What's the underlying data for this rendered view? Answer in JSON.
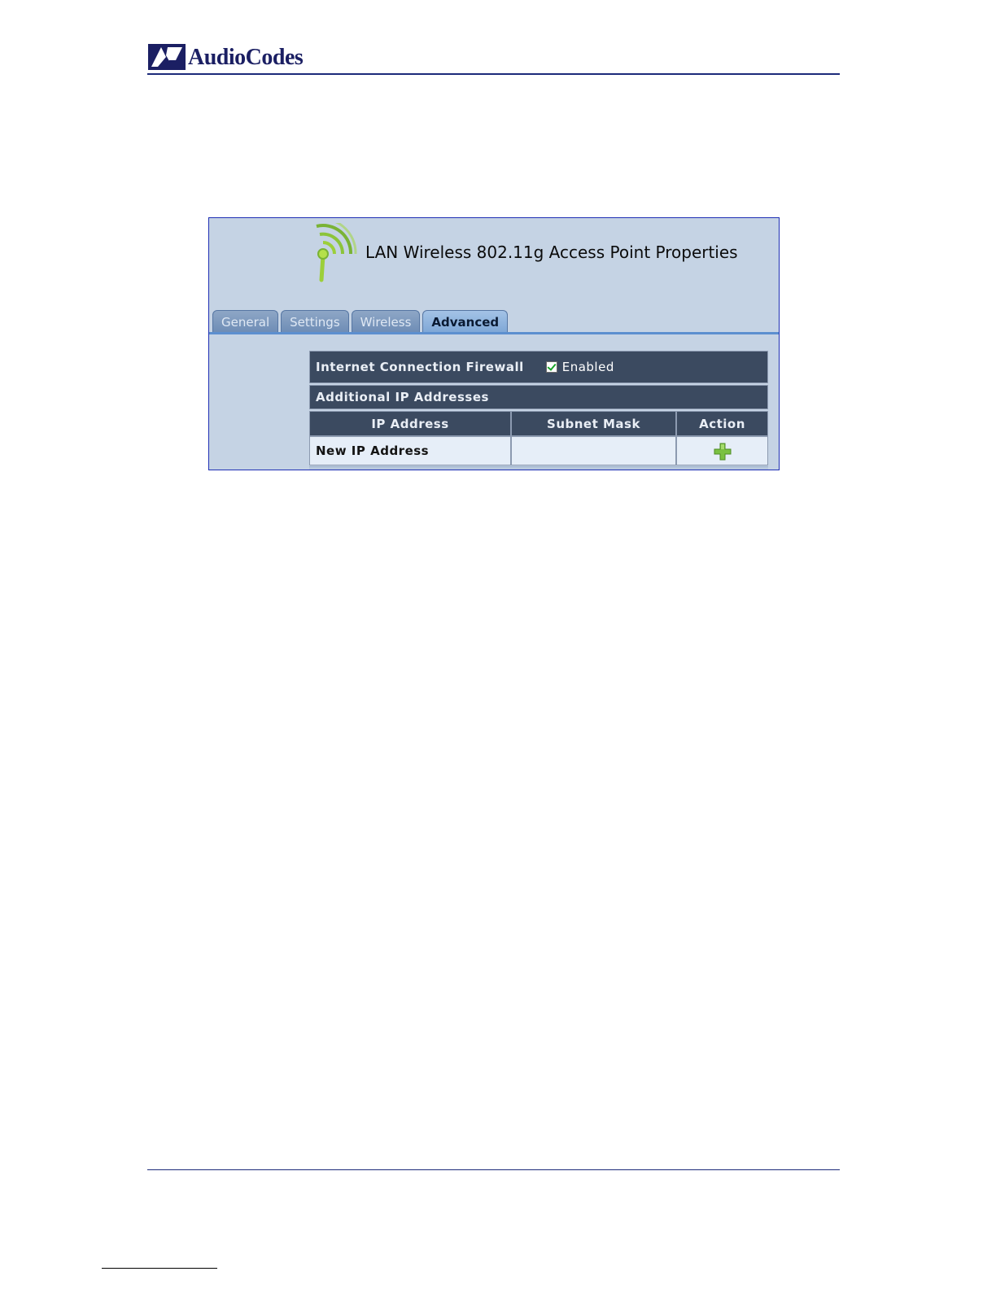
{
  "header": {
    "brand": "AudioCodes"
  },
  "panel": {
    "title": "LAN Wireless 802.11g Access Point Properties",
    "tabs": [
      {
        "label": "General",
        "active": false
      },
      {
        "label": "Settings",
        "active": false
      },
      {
        "label": "Wireless",
        "active": false
      },
      {
        "label": "Advanced",
        "active": true
      }
    ],
    "firewall": {
      "label": "Internet Connection Firewall",
      "checkbox_label": "Enabled",
      "checked": true
    },
    "additional_ip": {
      "label": "Additional IP Addresses",
      "columns": [
        "IP Address",
        "Subnet Mask",
        "Action"
      ],
      "rows": [
        {
          "ip_address": "New IP Address",
          "subnet_mask": "",
          "action_icon": "add-icon"
        }
      ]
    }
  },
  "colors": {
    "brand": "#1b1f63",
    "rule": "#1c2a7a",
    "panel_bg": "#c5d3e4",
    "row_dark": "#3b4a60",
    "tab_active": "#7ea6d6",
    "add_green": "#7ac142"
  }
}
